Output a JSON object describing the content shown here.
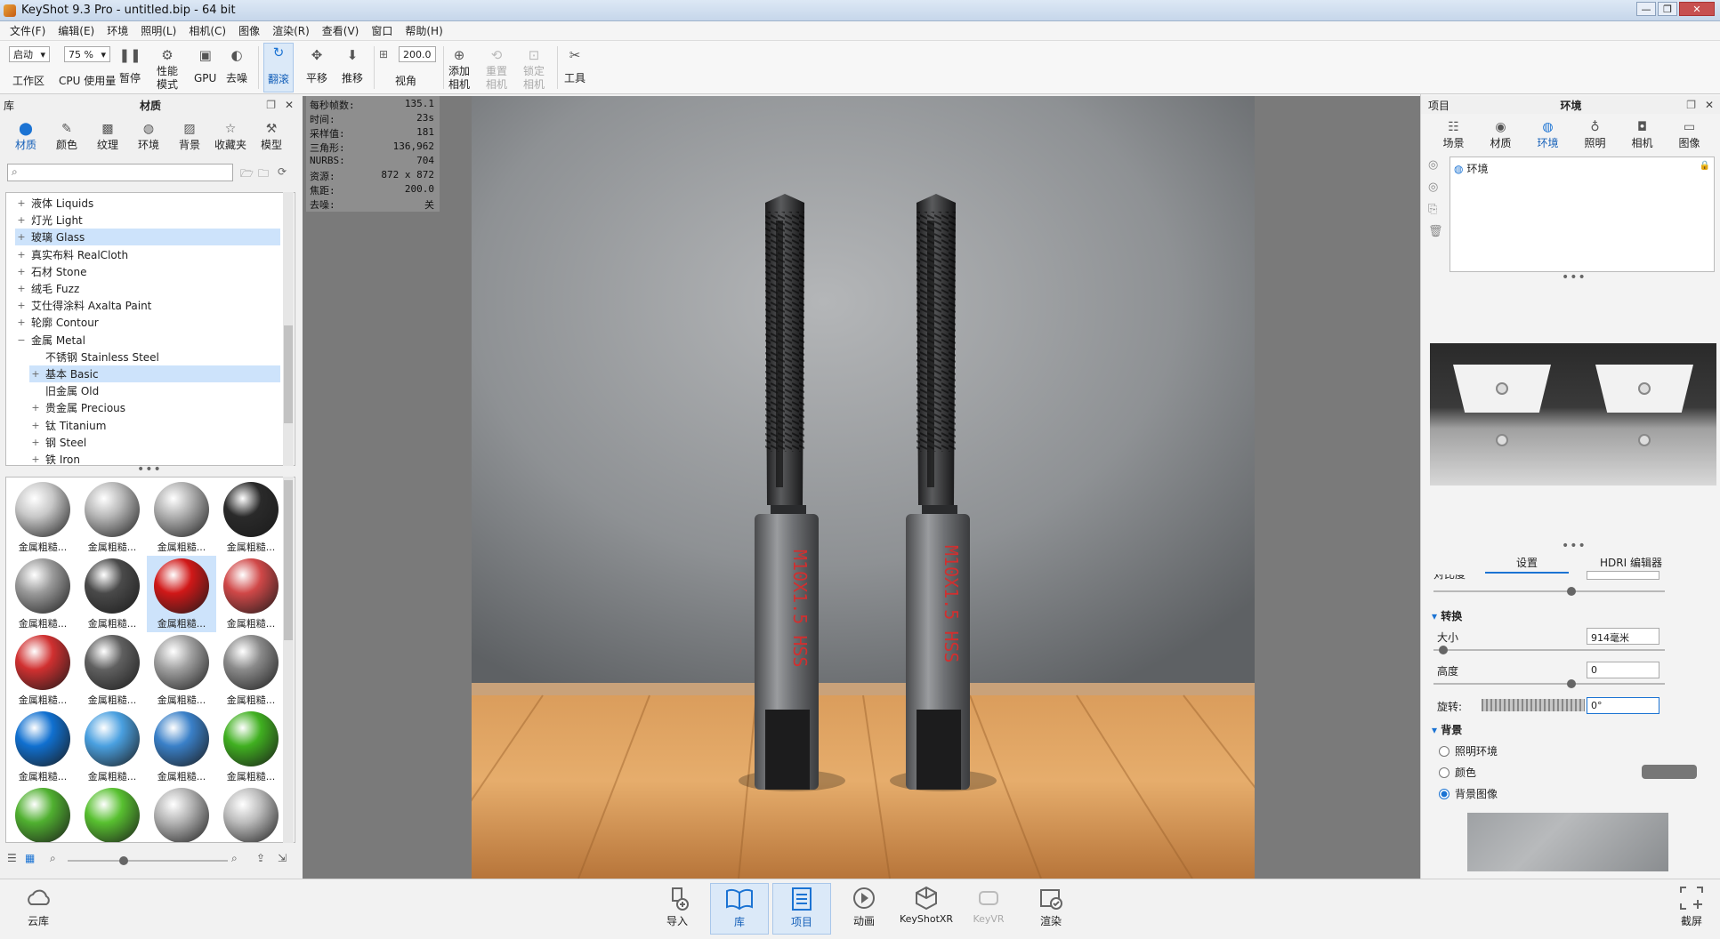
{
  "window": {
    "title": "KeyShot 9.3 Pro  - untitled.bip  - 64 bit"
  },
  "menu": [
    "文件(F)",
    "编辑(E)",
    "环境",
    "照明(L)",
    "相机(C)",
    "图像",
    "渲染(R)",
    "查看(V)",
    "窗口",
    "帮助(H)"
  ],
  "toolbar": {
    "workspace_value": "启动",
    "workspace_label": "工作区",
    "cpu_value": "75 %",
    "cpu_label": "CPU 使用量",
    "pause": "暂停",
    "perf_line1": "性能",
    "perf_line2": "模式",
    "gpu": "GPU",
    "denoise": "去噪",
    "tumble": "翻滚",
    "pan": "平移",
    "dolly": "推移",
    "fov_value": "200.0",
    "fov_label": "视角",
    "add_cam_1": "添加",
    "add_cam_2": "相机",
    "reset_cam_1": "重置",
    "reset_cam_2": "相机",
    "lock_cam_1": "锁定",
    "lock_cam_2": "相机",
    "tools": "工具"
  },
  "library": {
    "header_left": "库",
    "title": "材质",
    "tabs": [
      "材质",
      "颜色",
      "纹理",
      "环境",
      "背景",
      "收藏夹",
      "模型"
    ],
    "tree": [
      {
        "pm": "+",
        "label": "液体 Liquids",
        "indent": 0,
        "sel": false
      },
      {
        "pm": "+",
        "label": "灯光 Light",
        "indent": 0,
        "sel": false
      },
      {
        "pm": "+",
        "label": "玻璃 Glass",
        "indent": 0,
        "sel": true
      },
      {
        "pm": "+",
        "label": "真实布料 RealCloth",
        "indent": 0,
        "sel": false
      },
      {
        "pm": "+",
        "label": "石材 Stone",
        "indent": 0,
        "sel": false
      },
      {
        "pm": "+",
        "label": "绒毛 Fuzz",
        "indent": 0,
        "sel": false
      },
      {
        "pm": "+",
        "label": "艾仕得涂料 Axalta Paint",
        "indent": 0,
        "sel": false
      },
      {
        "pm": "+",
        "label": "轮廓 Contour",
        "indent": 0,
        "sel": false
      },
      {
        "pm": "−",
        "label": "金属 Metal",
        "indent": 0,
        "sel": false
      },
      {
        "pm": "",
        "label": "不锈钢 Stainless Steel",
        "indent": 1,
        "sel": false
      },
      {
        "pm": "+",
        "label": "基本 Basic",
        "indent": 1,
        "sel": true
      },
      {
        "pm": "",
        "label": "旧金属 Old",
        "indent": 1,
        "sel": false
      },
      {
        "pm": "+",
        "label": "贵金属 Precious",
        "indent": 1,
        "sel": false
      },
      {
        "pm": "+",
        "label": "钛 Titanium",
        "indent": 1,
        "sel": false
      },
      {
        "pm": "+",
        "label": "钢 Steel",
        "indent": 1,
        "sel": false
      },
      {
        "pm": "+",
        "label": "铁 Iron",
        "indent": 1,
        "sel": false
      }
    ],
    "thumb_caption": "金属粗糙...",
    "thumb_colors": [
      "#c8c8c8",
      "#b8b8b8",
      "#b0b0b0",
      "#2a2a2a",
      "#9a9a9a",
      "#4a4a4a",
      "#d01818",
      "#d04848",
      "#d03030",
      "#606060",
      "#a0a0a0",
      "#8a8a8a",
      "#1070d0",
      "#4aa0e0",
      "#3a80c8",
      "#40b020",
      "#50b030",
      "#58c030",
      "#b4b4b4",
      "#bcbcbc"
    ],
    "selected_thumb": 6
  },
  "stats": [
    {
      "k": "每秒帧数:",
      "v": "135.1"
    },
    {
      "k": "时间:",
      "v": "23s"
    },
    {
      "k": "采样值:",
      "v": "181"
    },
    {
      "k": "三角形:",
      "v": "136,962"
    },
    {
      "k": "NURBS:",
      "v": "704"
    },
    {
      "k": "资源:",
      "v": "872 x 872"
    },
    {
      "k": "焦距:",
      "v": "200.0"
    },
    {
      "k": "去噪:",
      "v": "关"
    }
  ],
  "scene": {
    "tap_text": "M10X1.5 HSS"
  },
  "bottom": [
    "云库",
    "导入",
    "库",
    "项目",
    "动画",
    "KeyShotXR",
    "KeyVR",
    "渲染",
    "截屏"
  ],
  "project": {
    "header_left": "项目",
    "title": "环境",
    "tabs": [
      "场景",
      "材质",
      "环境",
      "照明",
      "相机",
      "图像"
    ],
    "env_item": "环境",
    "subtabs": [
      "设置",
      "HDRI 编辑器"
    ],
    "partial_label": "对比度",
    "sec_transform": "转换",
    "size_label": "大小",
    "size_value": "914毫米",
    "height_label": "高度",
    "height_value": "0",
    "rotate_label": "旋转:",
    "rotate_value": "0°",
    "sec_background": "背景",
    "bg_options": [
      "照明环境",
      "颜色",
      "背景图像"
    ],
    "bg_selected": 2
  }
}
